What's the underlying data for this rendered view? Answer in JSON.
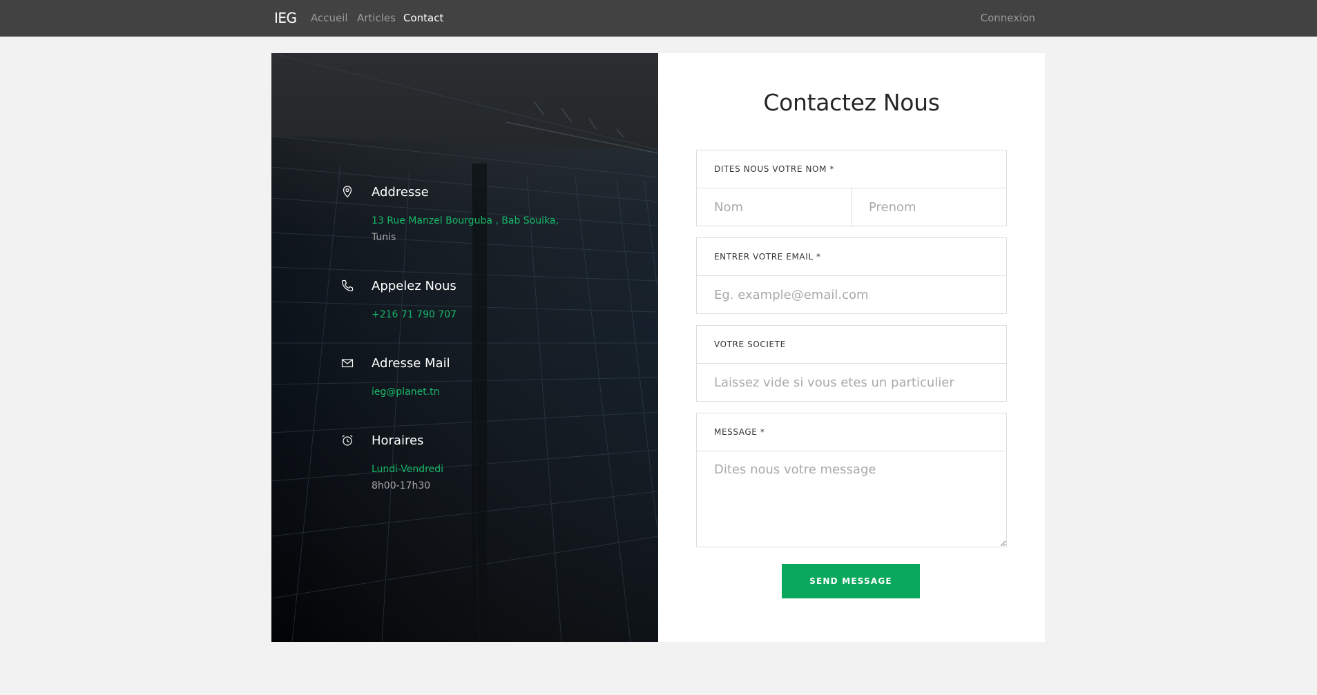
{
  "nav": {
    "brand": "IEG",
    "links": [
      "Accueil",
      "Articles",
      "Contact"
    ],
    "active": "Contact",
    "login": "Connexion"
  },
  "info": {
    "address": {
      "title": "Addresse",
      "line1": "13 Rue Manzel Bourguba , Bab Souika,",
      "line2": "Tunis",
      "icon": "map-pin-icon"
    },
    "phone": {
      "title": "Appelez Nous",
      "line1": "+216 71 790 707",
      "icon": "phone-icon"
    },
    "mail": {
      "title": "Adresse Mail",
      "line1": "ieg@planet.tn",
      "icon": "mail-icon"
    },
    "hours": {
      "title": "Horaires",
      "line1": "Lundi-Vendredi",
      "line2": "8h00-17h30",
      "icon": "alarm-clock-icon"
    }
  },
  "form": {
    "title": "Contactez Nous",
    "name_label": "DITES NOUS VOTRE NOM *",
    "nom_placeholder": "Nom",
    "prenom_placeholder": "Prenom",
    "email_label": "ENTRER VOTRE EMAIL *",
    "email_placeholder": "Eg. example@email.com",
    "company_label": "VOTRE SOCIETE",
    "company_placeholder": "Laissez vide si vous etes un particulier",
    "message_label": "MESSAGE *",
    "message_placeholder": "Dites nous votre message",
    "submit_label": "SEND MESSAGE"
  },
  "colors": {
    "navbar": "#424242",
    "accent_green": "#0aa85c",
    "info_green": "#17b76a",
    "page_bg": "#f2f2f2"
  }
}
